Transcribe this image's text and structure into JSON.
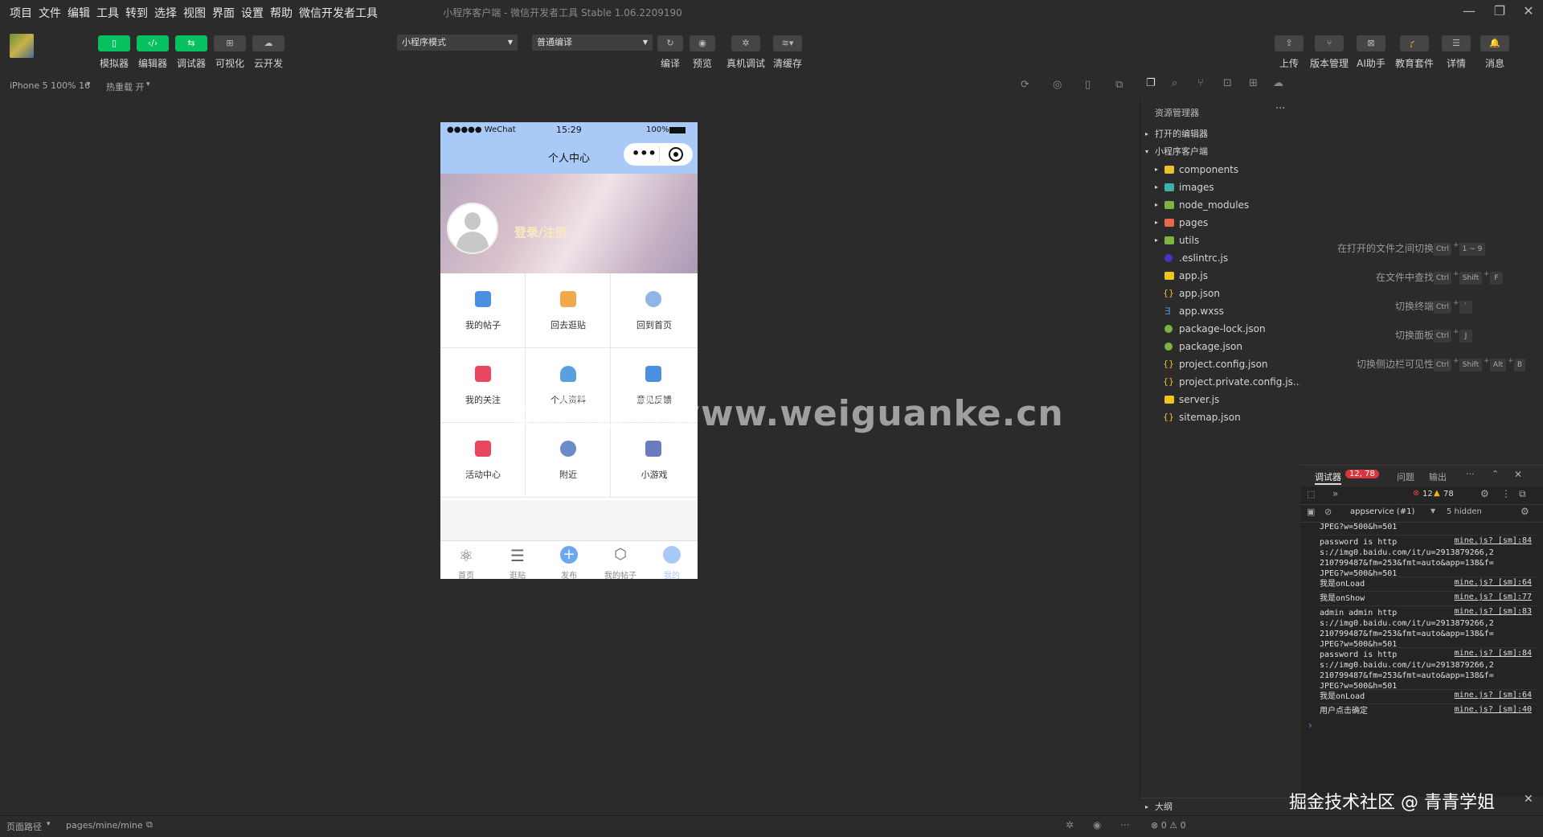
{
  "menubar": [
    "项目",
    "文件",
    "编辑",
    "工具",
    "转到",
    "选择",
    "视图",
    "界面",
    "设置",
    "帮助",
    "微信开发者工具"
  ],
  "window_title": "小程序客户端 - 微信开发者工具 Stable 1.06.2209190",
  "toolbar": {
    "left_buttons": [
      "模拟器",
      "编辑器",
      "调试器",
      "可视化",
      "云开发"
    ],
    "mode_select": "小程序模式",
    "compile_select": "普通编译",
    "mid_buttons": [
      "编译",
      "预览",
      "真机调试",
      "清缓存"
    ],
    "right_buttons": [
      "上传",
      "版本管理",
      "AI助手",
      "教育套件",
      "详情",
      "消息"
    ]
  },
  "subbar": {
    "device": "iPhone 5 100% 16",
    "hotreload": "热重载 开"
  },
  "phone": {
    "carrier": "●●●●● WeChat",
    "time": "15:29",
    "battery": "100%",
    "nav_title": "个人中心",
    "capsule_more": "•••",
    "login_text": "登录/注册",
    "grid": [
      {
        "label": "我的帖子",
        "color": "#4a90e2"
      },
      {
        "label": "回去逛贴",
        "color": "#f0a94b"
      },
      {
        "label": "回到首页",
        "color": "#8fb6e6"
      },
      {
        "label": "我的关注",
        "color": "#e8475f"
      },
      {
        "label": "个人资料",
        "color": "#5aa0e0"
      },
      {
        "label": "意见反馈",
        "color": "#4a90e2"
      },
      {
        "label": "活动中心",
        "color": "#e8475f"
      },
      {
        "label": "附近",
        "color": "#6a8cc7"
      },
      {
        "label": "小游戏",
        "color": "#6a7bbf"
      }
    ],
    "tabs": [
      "首页",
      "逛贴",
      "发布",
      "我的帖子",
      "我的"
    ]
  },
  "explorer": {
    "title": "资源管理器",
    "more": "···",
    "open_editors": "打开的编辑器",
    "project": "小程序客户端",
    "folders": [
      {
        "name": "components",
        "color": "#e8c12c"
      },
      {
        "name": "images",
        "color": "#3bb3a8"
      },
      {
        "name": "node_modules",
        "color": "#7cb342"
      },
      {
        "name": "pages",
        "color": "#e8684a"
      },
      {
        "name": "utils",
        "color": "#7cb342"
      }
    ],
    "files": [
      {
        "name": ".eslintrc.js",
        "icon": "eslint-icon",
        "color": "#4b32c3"
      },
      {
        "name": "app.js",
        "icon": "js-icon",
        "color": "#f0c419"
      },
      {
        "name": "app.json",
        "icon": "json-icon",
        "color": "#e8c12c"
      },
      {
        "name": "app.wxss",
        "icon": "css-icon",
        "color": "#3f8ed8"
      },
      {
        "name": "package-lock.json",
        "icon": "npm-icon",
        "color": "#7cb342"
      },
      {
        "name": "package.json",
        "icon": "npm-icon",
        "color": "#7cb342"
      },
      {
        "name": "project.config.json",
        "icon": "json-icon",
        "color": "#e8c12c"
      },
      {
        "name": "project.private.config.js...",
        "icon": "json-icon",
        "color": "#e8c12c"
      },
      {
        "name": "server.js",
        "icon": "js-icon",
        "color": "#f0c419"
      },
      {
        "name": "sitemap.json",
        "icon": "json-icon",
        "color": "#e8c12c"
      }
    ],
    "outline": "大纲",
    "status": "⊗ 0 ⚠ 0"
  },
  "shortcuts": [
    {
      "label": "在打开的文件之间切换",
      "keys": [
        "Ctrl",
        "1 ~ 9"
      ]
    },
    {
      "label": "在文件中查找",
      "keys": [
        "Ctrl",
        "Shift",
        "F"
      ]
    },
    {
      "label": "切换终端",
      "keys": [
        "Ctrl",
        "`"
      ]
    },
    {
      "label": "切换面板",
      "keys": [
        "Ctrl",
        "J"
      ]
    },
    {
      "label": "切换侧边栏可见性",
      "keys": [
        "Ctrl",
        "Shift",
        "Alt",
        "B"
      ]
    }
  ],
  "debugger": {
    "tab_debug": "调试器",
    "badge": "12, 78",
    "tab_issues": "问题",
    "tab_output": "输出",
    "errors": "12",
    "warnings": "78",
    "context": "appservice (#1)",
    "hidden": "5 hidden",
    "logs": [
      {
        "text": "JPEG?w=500&h=501",
        "src": ""
      },
      {
        "text": "password is http s://img0.baidu.com/it/u=2913879266,2 210799487&fm=253&fmt=auto&app=138&f= JPEG?w=500&h=501",
        "src": "mine.js? [sm]:84"
      },
      {
        "text": "我是onLoad",
        "src": "mine.js? [sm]:64"
      },
      {
        "text": "我是onShow",
        "src": "mine.js? [sm]:77"
      },
      {
        "text": "admin admin http s://img0.baidu.com/it/u=2913879266,2 210799487&fm=253&fmt=auto&app=138&f= JPEG?w=500&h=501",
        "src": "mine.js? [sm]:83"
      },
      {
        "text": "password is http s://img0.baidu.com/it/u=2913879266,2 210799487&fm=253&fmt=auto&app=138&f= JPEG?w=500&h=501",
        "src": "mine.js? [sm]:84"
      },
      {
        "text": "我是onLoad",
        "src": "mine.js? [sm]:64"
      },
      {
        "text": "用户点击确定",
        "src": "mine.js? [sm]:40"
      }
    ],
    "prompt": "›"
  },
  "statusbar": {
    "path_label": "页面路径",
    "path": "pages/mine/mine"
  },
  "watermark": "cn国观客www.weiguanke.cn",
  "corner_watermark": "掘金技术社区 @ 青青学姐"
}
